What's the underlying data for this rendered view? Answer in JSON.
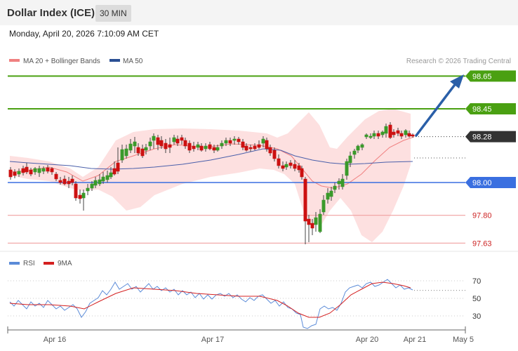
{
  "header": {
    "title": "Dollar Index (ICE)",
    "interval": "30 MIN",
    "datetime": "Monday, April 20, 2026 7:10:09 AM CET"
  },
  "legend": {
    "ma20": "MA 20 + Bollinger Bands",
    "ma50": "MA 50",
    "rsi": "RSI",
    "rsi_ma": "9MA"
  },
  "credit": "Research © 2026 Trading Central",
  "colors": {
    "up": "#3a9a2b",
    "down": "#cc1111",
    "bollinger_fill": "#fde0e0",
    "ma20": "#f08080",
    "ma50": "#4a5faa",
    "resistance": "#4aa012",
    "support": "#3a6fe0",
    "support_light": "#f0a0a0",
    "rsi": "#5b8bd8",
    "rsi_ma": "#d42020",
    "arrow": "#2a5fa8"
  },
  "chart_data": {
    "type": "candlestick",
    "price_ylim": [
      97.6,
      98.75
    ],
    "levels": [
      {
        "value": 98.65,
        "label": "98.65",
        "kind": "resistance"
      },
      {
        "value": 98.45,
        "label": "98.45",
        "kind": "resistance"
      },
      {
        "value": 98.28,
        "label": "98.28",
        "kind": "last"
      },
      {
        "value": 98.0,
        "label": "98.00",
        "kind": "support"
      },
      {
        "value": 97.8,
        "label": "97.80",
        "kind": "support-light"
      },
      {
        "value": 97.63,
        "label": "97.63",
        "kind": "support-light"
      }
    ],
    "ma50_end": 98.15,
    "x_ticks": [
      "Apr 16",
      "Apr 17",
      "Apr 20",
      "Apr 21",
      "May 5"
    ],
    "rsi_ylim": [
      20,
      80
    ],
    "rsi_ticks": [
      "70",
      "50",
      "30"
    ],
    "rsi_end": 59
  }
}
